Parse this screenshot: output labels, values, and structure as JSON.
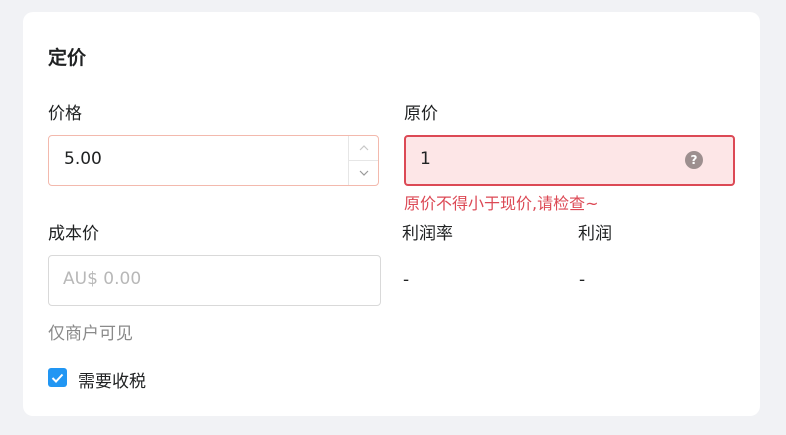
{
  "section": {
    "title": "定价"
  },
  "price": {
    "label": "价格",
    "value": "5.00"
  },
  "original_price": {
    "label": "原价",
    "value": "1",
    "error": "原价不得小于现价,请检查~"
  },
  "cost": {
    "label": "成本价",
    "placeholder": "AU$ 0.00",
    "hint": "仅商户可见"
  },
  "margin": {
    "label": "利润率",
    "value": "-"
  },
  "profit": {
    "label": "利润",
    "value": "-"
  },
  "tax": {
    "label": "需要收税",
    "checked": true
  },
  "colors": {
    "error": "#dc4955",
    "error_bg": "#fde6e7",
    "checkbox": "#2196f3"
  },
  "icons": [
    "chevron-up-icon",
    "chevron-down-icon",
    "question-icon",
    "checkmark-icon"
  ]
}
